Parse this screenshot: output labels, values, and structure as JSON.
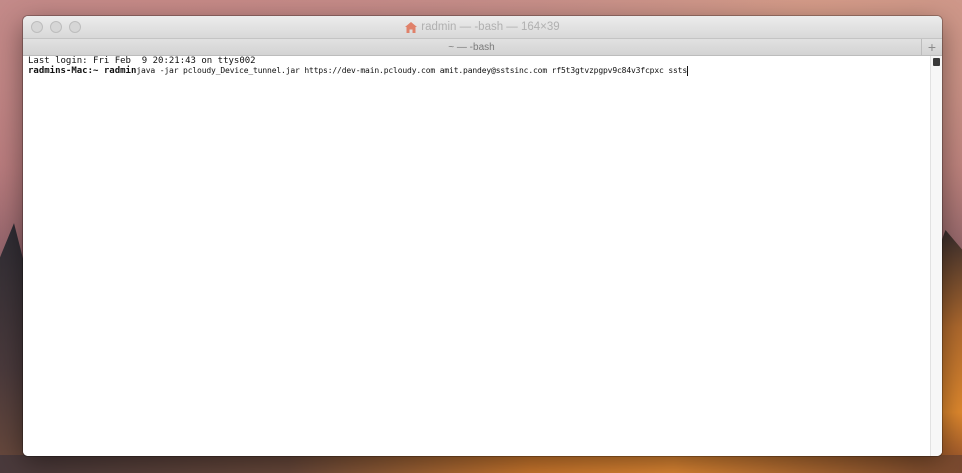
{
  "window": {
    "title": "radmin — -bash — 164×39",
    "tab_title": "~ — -bash",
    "new_tab_label": "+"
  },
  "terminal": {
    "line1": "Last login: Fri Feb  9 20:21:43 on ttys002",
    "prompt": "radmins-Mac:~ radmin",
    "command": "java -jar pcloudy_Device_tunnel.jar https://dev-main.pcloudy.com amit.pandey@sstsinc.com rf5t3gtvzpgpv9c84v3fcpxc ssts"
  },
  "colors": {
    "title_text": "#b0b0b0",
    "home_icon": "#e0816a",
    "terminal_text": "#111111",
    "terminal_bg": "#ffffff"
  },
  "icons": {
    "home": "home-icon",
    "close": "close-icon",
    "minimize": "minimize-icon",
    "zoom": "zoom-icon",
    "new_tab": "plus-icon"
  }
}
